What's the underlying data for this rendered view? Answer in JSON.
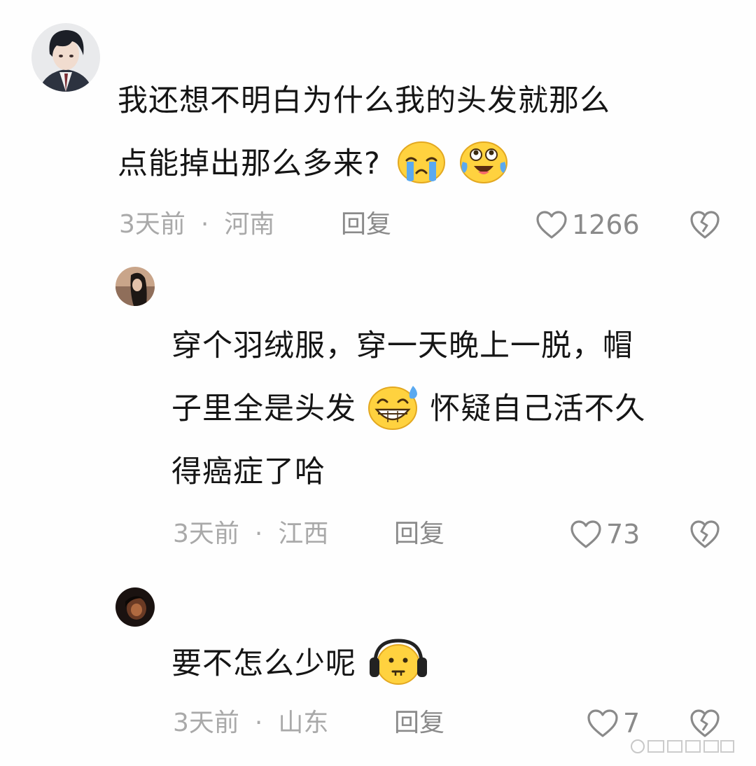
{
  "comments": [
    {
      "text_lines": [
        "我还想不明白为什么我的头发就那么",
        "点能掉出那么多来?"
      ],
      "emojis": [
        "crying-emoji",
        "laughing-crying-emoji"
      ],
      "time": "3天前",
      "location": "河南",
      "reply_label": "回复",
      "likes": "1266"
    },
    {
      "text_lines": [
        "穿个羽绒服，穿一天晚上一脱，帽",
        "子里全是头发",
        "怀疑自己活不久",
        "得癌症了哈"
      ],
      "emojis": [
        "grin-sweat-emoji"
      ],
      "time": "3天前",
      "location": "江西",
      "reply_label": "回复",
      "likes": "73"
    },
    {
      "text_lines": [
        "要不怎么少呢"
      ],
      "emojis": [
        "headphones-emoji"
      ],
      "time": "3天前",
      "location": "山东",
      "reply_label": "回复",
      "likes": "7"
    }
  ],
  "colors": {
    "text": "#151515",
    "meta": "#a9a9a9",
    "action": "#8a8a8a",
    "background": "#fefefe"
  }
}
